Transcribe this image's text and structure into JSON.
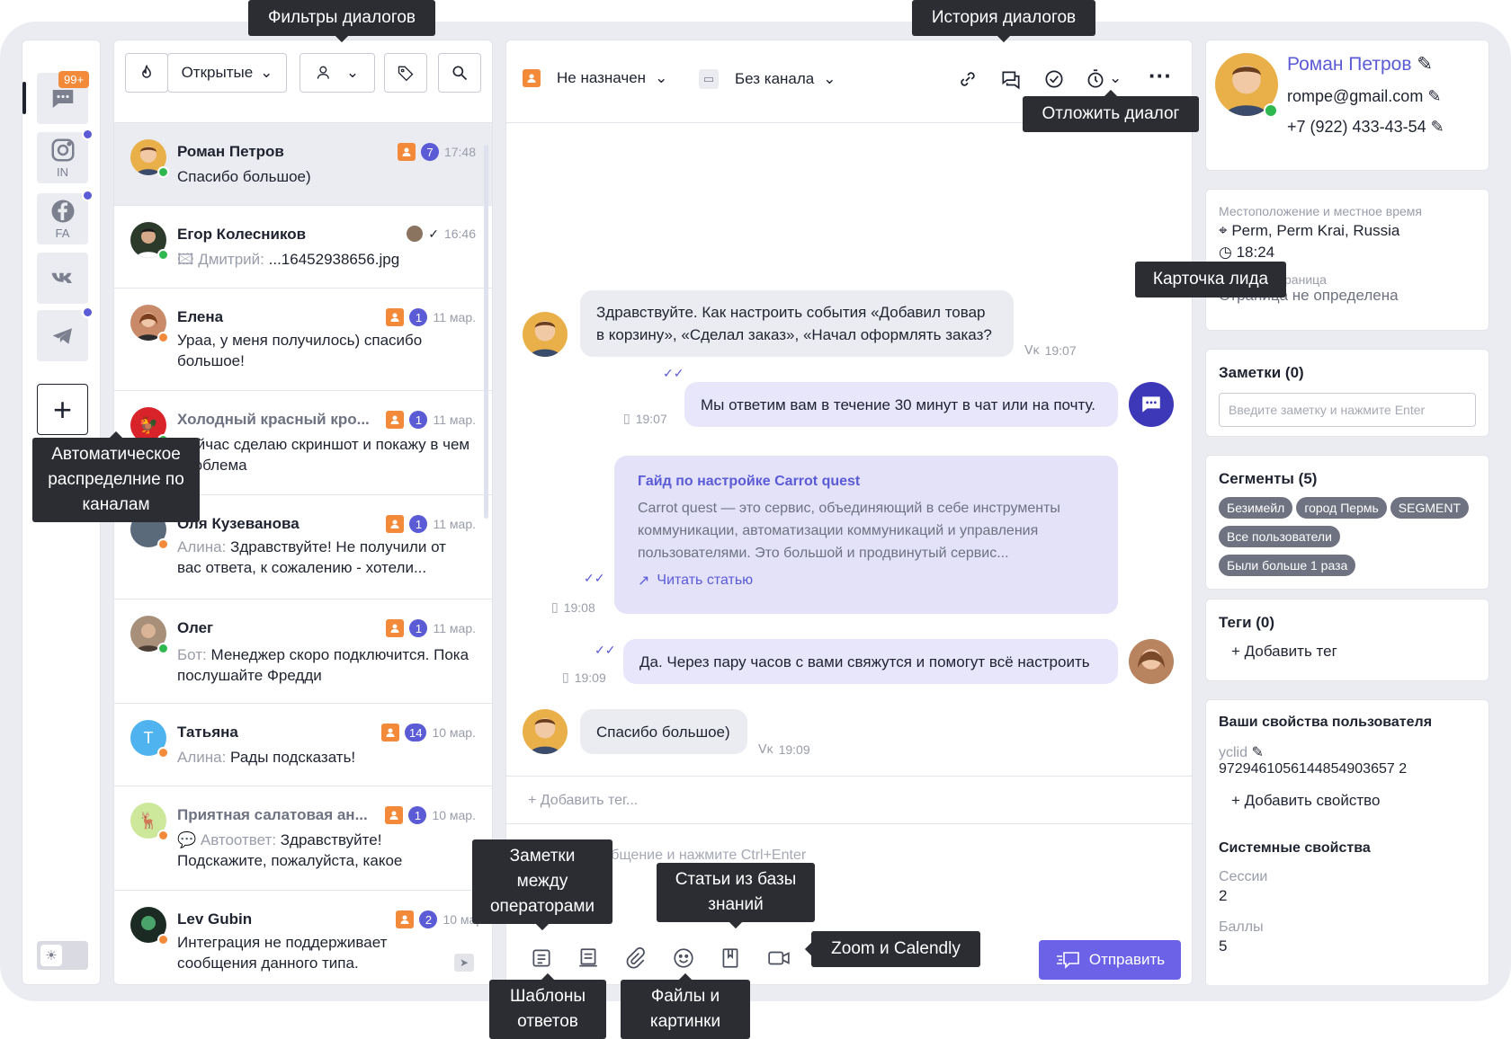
{
  "rail": {
    "badge": "99+",
    "channels": [
      {
        "icon": "chat-icon",
        "label": ""
      },
      {
        "icon": "instagram-icon",
        "label": "IN"
      },
      {
        "icon": "facebook-icon",
        "label": "FA"
      },
      {
        "icon": "vk-icon",
        "label": ""
      },
      {
        "icon": "telegram-icon",
        "label": ""
      }
    ]
  },
  "filters": {
    "status": "Открытые"
  },
  "dialogs": [
    {
      "name": "Роман Петров",
      "text": "Спасибо большое)",
      "prefix": "",
      "count": "7",
      "time": "17:48",
      "status": "green"
    },
    {
      "name": "Егор Колесников",
      "text": "...16452938656.jpg",
      "prefix": "Дмитрий: ",
      "count": "",
      "time": "16:46",
      "status": "green"
    },
    {
      "name": "Елена",
      "text": "Ураа, у меня получилось) спасибо большое!",
      "prefix": "",
      "count": "1",
      "time": "11 мар.",
      "status": "orange"
    },
    {
      "name": "Холодный красный кро...",
      "text": "Сейчас сделаю скриншот и покажу в чем проблема",
      "prefix": "",
      "count": "1",
      "time": "11 мар.",
      "status": "green"
    },
    {
      "name": "Оля Кузеванова",
      "text": "Здравствуйте! Не получили от вас ответа, к сожалению - хотели...",
      "prefix": "Алина: ",
      "count": "1",
      "time": "11 мар.",
      "status": "orange"
    },
    {
      "name": "Олег",
      "text": "Менеджер скоро подключится. Пока послушайте Фредди",
      "prefix": "Бот: ",
      "count": "1",
      "time": "11 мар.",
      "status": "green"
    },
    {
      "name": "Татьяна",
      "text": "Рады подсказать!",
      "prefix": "Алина: ",
      "count": "14",
      "time": "10 мар.",
      "status": "orange"
    },
    {
      "name": "Приятная салатовая ан...",
      "text": "Здравствуйте! Подскажите, пожалуйста, какое",
      "prefix": "Автоответ: ",
      "count": "1",
      "time": "10 мар.",
      "status": "orange"
    },
    {
      "name": "Lev Gubin",
      "text": "Интеграция не поддерживает сообщения данного типа.",
      "prefix": "",
      "count": "2",
      "time": "10 мар.",
      "status": "orange"
    }
  ],
  "chat": {
    "assignee": "Не назначен",
    "channel": "Без канала",
    "messages": {
      "m1": "Здравствуйте. Как настроить события «Добавил товар в корзину», «Сделал заказ», «Начал оформлять заказ?",
      "m1_time": "19:07",
      "m2": "Мы ответим вам в течение 30 минут в чат или на почту.",
      "m2_time": "19:07",
      "article_title": "Гайд по настройке Carrot quest",
      "article_body": "Carrot quest — это сервис, объединяющий в себе инструменты коммуникации, автоматизации коммуникаций и управления пользователями. Это большой и продвинутый сервис...",
      "article_link": "Читать статью",
      "article_time": "19:08",
      "m3": "Да. Через пару часов с вами свяжутся и помогут всё настроить",
      "m3_time": "19:09",
      "m4": "Спасибо большое)",
      "m4_time": "19:09"
    },
    "add_tag": "+ Добавить тег...",
    "composer_placeholder": "Введите сообщение и нажмите Ctrl+Enter",
    "send": "Отправить"
  },
  "lead": {
    "name": "Роман Петров",
    "email": "rompe@gmail.com",
    "phone": "+7 (922) 433-43-54",
    "location_label": "Местоположение и местное время",
    "location": "Perm, Perm Krai, Russia",
    "local_time": "18:24",
    "page_label": "Текущая страница",
    "page_value": "Страница не определена",
    "notes_title": "Заметки (0)",
    "notes_placeholder": "Введите заметку и нажмите Enter",
    "segments_title": "Сегменты (5)",
    "segments": [
      "Безимейл",
      "город Пермь",
      "SEGMENT",
      "Все пользователи",
      "Были больше 1 раза"
    ],
    "tags_title": "Теги (0)",
    "add_tag": "Добавить тег",
    "props_title": "Ваши свойства пользователя",
    "prop_name": "yclid",
    "prop_value": "9729461056144854903657 2",
    "add_prop": "Добавить свойство",
    "sys_title": "Системные свойства",
    "sessions_label": "Сессии",
    "sessions": "2",
    "points_label": "Баллы",
    "points": "5"
  },
  "tooltips": {
    "filters": "Фильтры диалогов",
    "history": "История диалогов",
    "postpone": "Отложить диалог",
    "lead_card": "Карточка лида",
    "auto": "Автоматическое распределние по каналам",
    "notes": "Заметки между операторами",
    "kb": "Статьи из базы знаний",
    "zoom": "Zoom и Calendly",
    "templates": "Шаблоны ответов",
    "files": "Файлы и картинки"
  }
}
